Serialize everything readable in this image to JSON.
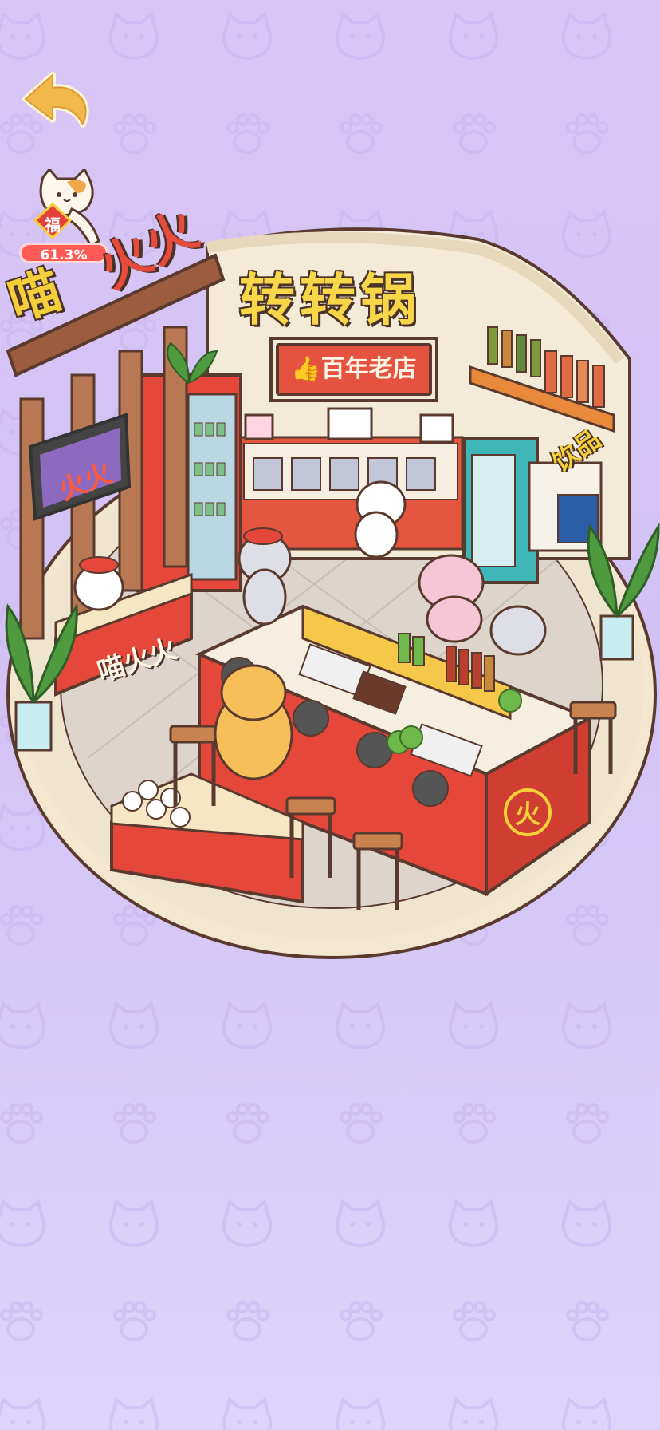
{
  "back_button": {
    "icon": "back-arrow-icon"
  },
  "badge": {
    "character": "福",
    "percent": "61.3%"
  },
  "shop": {
    "main_sign": "转转锅",
    "side_sign_top": "火火",
    "side_sign_cat": "喵",
    "plaque": "👍百年老店",
    "drinks_label": "饮品",
    "counter_sign": "喵火火",
    "tv_sign": "火火",
    "emblem": "火"
  },
  "colors": {
    "background_top": "#d9c6f6",
    "background_bottom": "#dcd4fa",
    "accent_red": "#e5523f",
    "accent_yellow": "#f5cf3a",
    "outline_brown": "#4a3228"
  }
}
